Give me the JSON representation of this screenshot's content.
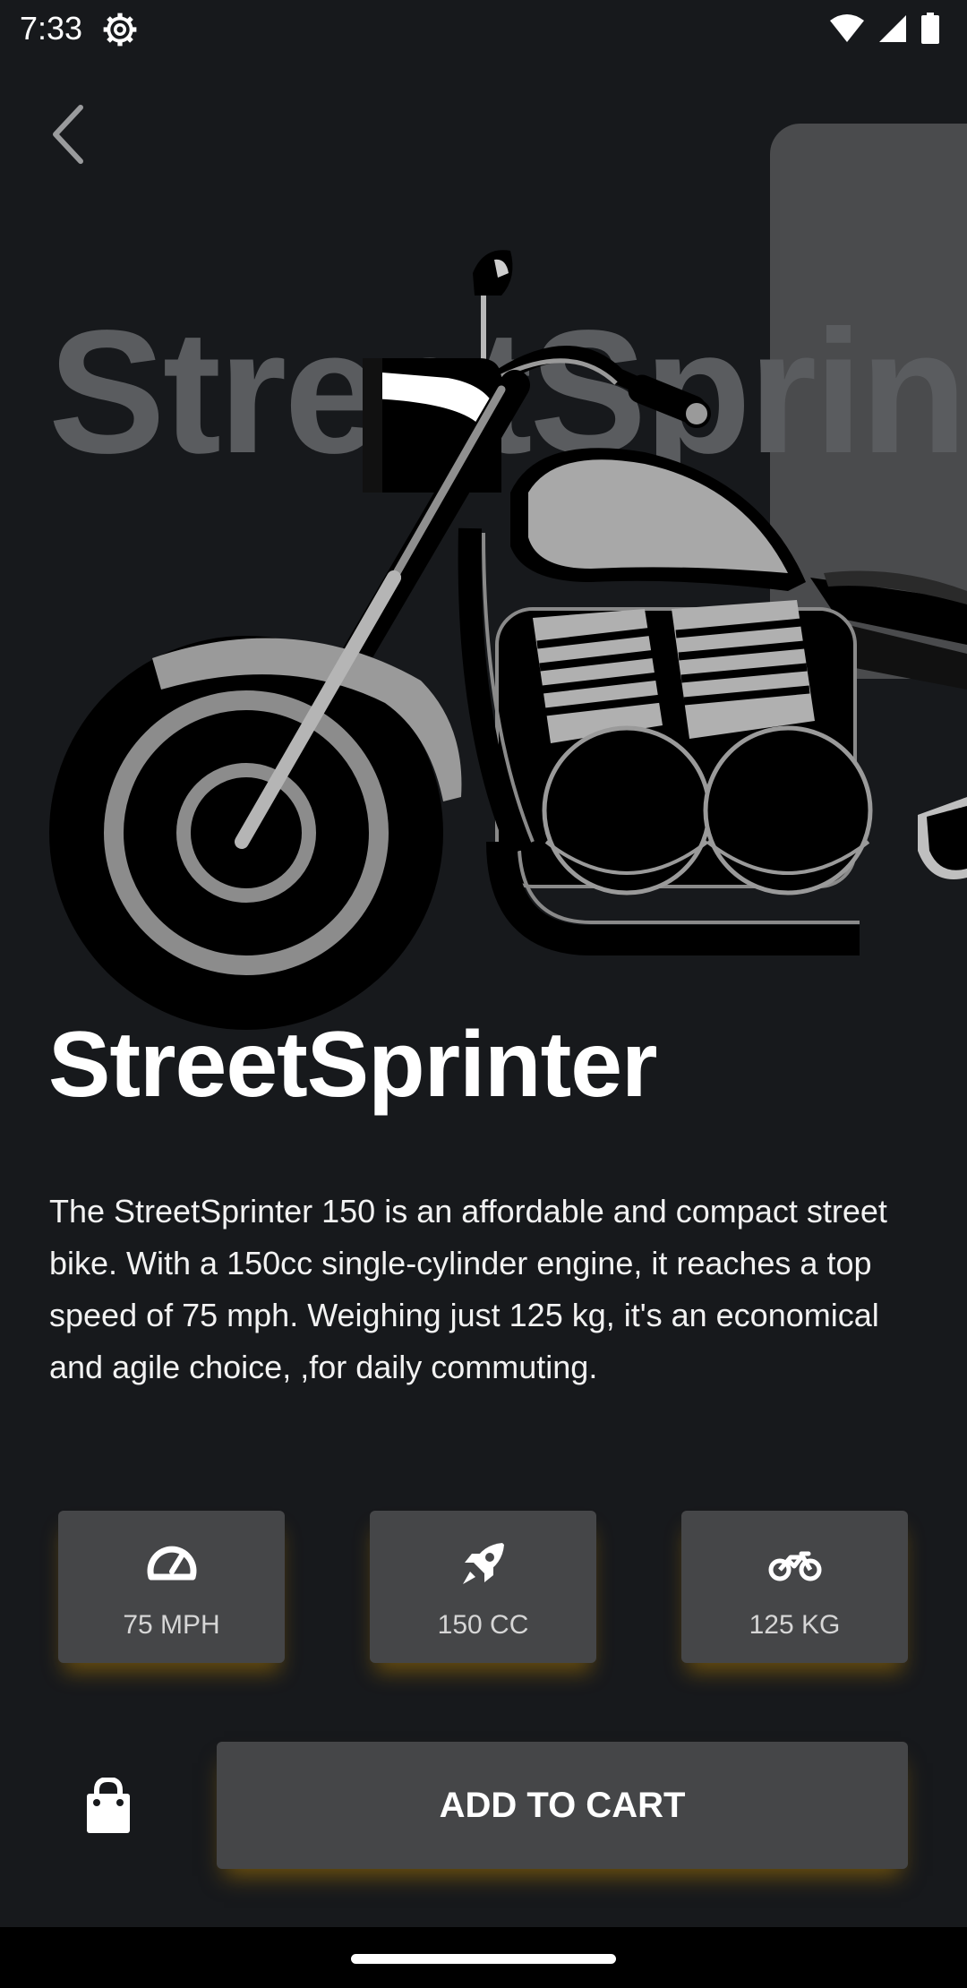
{
  "status_bar": {
    "time": "7:33",
    "icons": [
      "settings-icon",
      "wifi-icon",
      "signal-icon",
      "battery-icon"
    ]
  },
  "header": {
    "back_icon": "chevron-left-icon"
  },
  "hero": {
    "watermark": "StreetSprint",
    "image": "motorcycle-illustration"
  },
  "product": {
    "name": "StreetSprinter",
    "description": "The StreetSprinter 150 is an affordable and compact street bike. With a 150cc single-cylinder engine, it reaches a top speed of 75 mph. Weighing just 125 kg, it's an economical and agile choice, ,for daily commuting."
  },
  "specs": [
    {
      "icon": "speedometer-icon",
      "label": "75 MPH"
    },
    {
      "icon": "rocket-icon",
      "label": "150 CC"
    },
    {
      "icon": "motorcycle-icon",
      "label": "125 KG"
    }
  ],
  "actions": {
    "bag_icon": "shopping-bag-icon",
    "add_to_cart_label": "ADD TO CART"
  },
  "colors": {
    "background": "#17191c",
    "card": "#454648",
    "glow": "#c88c00",
    "text": "#ffffff"
  }
}
